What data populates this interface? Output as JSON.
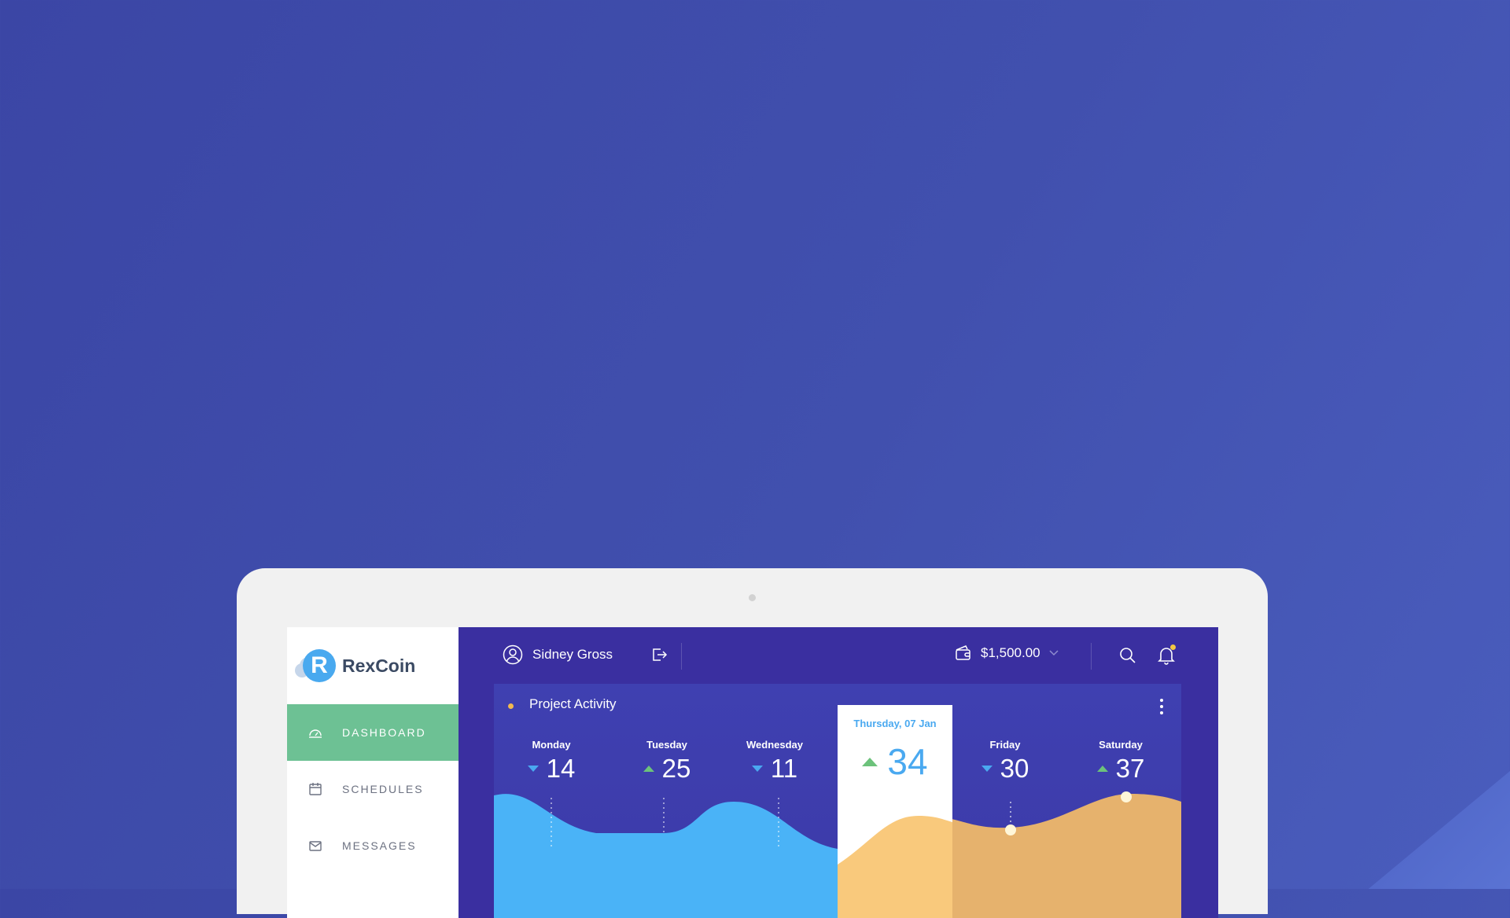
{
  "app": {
    "name": "RexCoin",
    "logo_letter": "R"
  },
  "sidebar": {
    "items": [
      {
        "label": "DASHBOARD",
        "icon": "gauge-icon",
        "active": true
      },
      {
        "label": "SCHEDULES",
        "icon": "calendar-icon",
        "active": false
      },
      {
        "label": "MESSAGES",
        "icon": "envelope-icon",
        "active": false
      }
    ]
  },
  "header": {
    "user_name": "Sidney Gross",
    "balance": "$1,500.00"
  },
  "panel": {
    "title": "Project Activity",
    "days": [
      {
        "name": "Monday",
        "value": "14",
        "trend": "down"
      },
      {
        "name": "Tuesday",
        "value": "25",
        "trend": "up"
      },
      {
        "name": "Wednesday",
        "value": "11",
        "trend": "down"
      },
      {
        "name": "Friday",
        "value": "30",
        "trend": "down"
      },
      {
        "name": "Saturday",
        "value": "37",
        "trend": "up"
      }
    ],
    "highlight": {
      "date": "Thursday, 07 Jan",
      "value": "34",
      "trend": "up"
    }
  },
  "colors": {
    "background": "#4150ae",
    "accent_green": "#6dc194",
    "accent_blue": "#4aa9f0",
    "wave_blue": "#4ab3f7",
    "wave_orange": "#f5be6e",
    "notification": "#f4c842"
  }
}
